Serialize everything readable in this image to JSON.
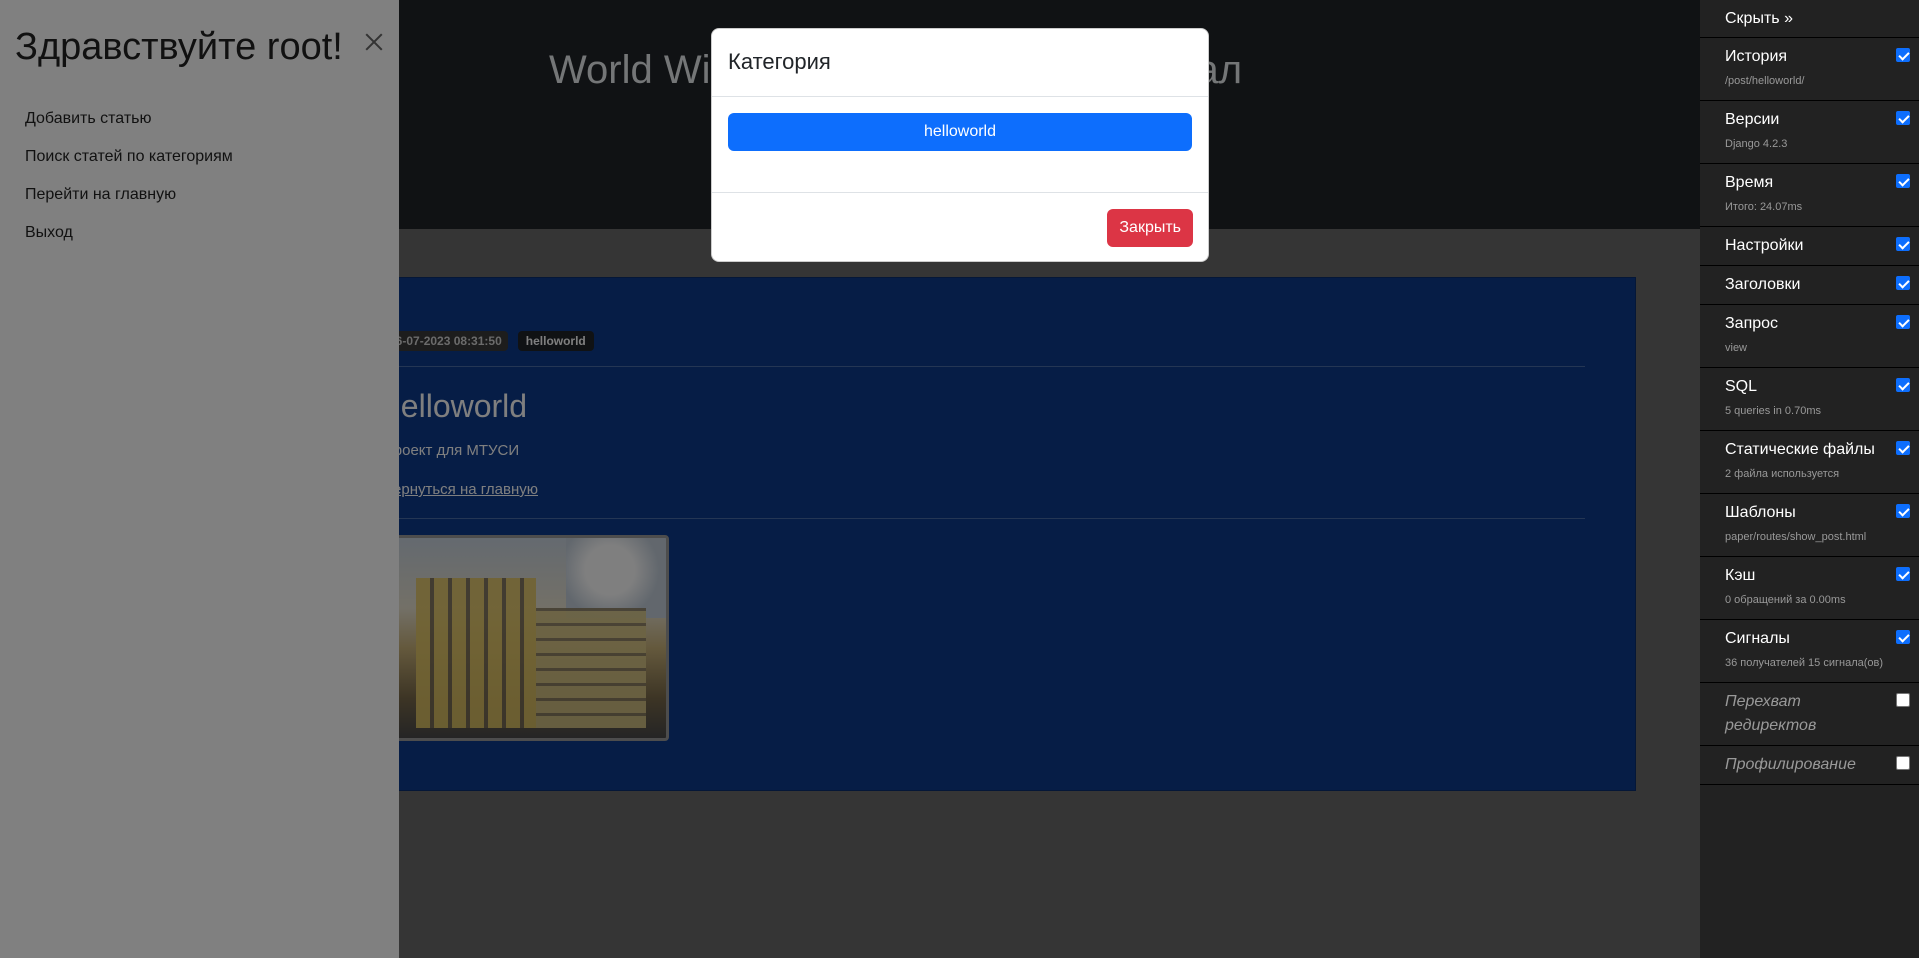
{
  "page": {
    "site_title": "World Wide Web — новостной портал",
    "post": {
      "date": "26-07-2023 08:31:50",
      "category_badge": "helloworld",
      "title": "helloworld",
      "subtitle": "Проект для МТУСИ",
      "back_link": "Вернуться на главную"
    }
  },
  "offcanvas": {
    "title": "Здравствуйте root!",
    "nav": [
      {
        "label": "Добавить статью"
      },
      {
        "label": "Поиск статей по категориям"
      },
      {
        "label": "Перейти на главную"
      },
      {
        "label": "Выход"
      }
    ]
  },
  "modal": {
    "title": "Категория",
    "category_button": "helloworld",
    "close_button": "Закрыть"
  },
  "debug_toolbar": {
    "hide_label": "Скрыть »",
    "panels": [
      {
        "title": "История",
        "sub": "/post/helloworld/",
        "checked": true
      },
      {
        "title": "Версии",
        "sub": "Django 4.2.3",
        "checked": true
      },
      {
        "title": "Время",
        "sub": "Итого: 24.07ms",
        "checked": true
      },
      {
        "title": "Настройки",
        "sub": "",
        "checked": true
      },
      {
        "title": "Заголовки",
        "sub": "",
        "checked": true
      },
      {
        "title": "Запрос",
        "sub": "view",
        "checked": true
      },
      {
        "title": "SQL",
        "sub": "5 queries in 0.70ms",
        "checked": true
      },
      {
        "title": "Статические файлы",
        "sub": "2 файла используется",
        "checked": true
      },
      {
        "title": "Шаблоны",
        "sub": "paper/routes/show_post.html",
        "checked": true
      },
      {
        "title": "Кэш",
        "sub": "0 обращений за 0.00ms",
        "checked": true
      },
      {
        "title": "Сигналы",
        "sub": "36 получателей 15 сигнала(ов)",
        "checked": true
      },
      {
        "title": "Перехват редиректов",
        "sub": "",
        "checked": false
      },
      {
        "title": "Профилирование",
        "sub": "",
        "checked": false
      }
    ]
  },
  "colors": {
    "primary": "#0d6efd",
    "danger": "#dc3545",
    "toolbar_bg": "#222222",
    "card_bg": "#0d3b8c"
  }
}
